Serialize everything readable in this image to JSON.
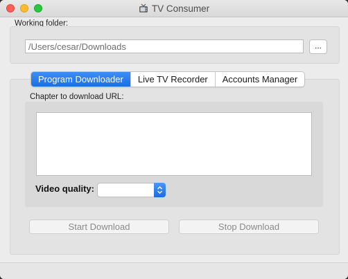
{
  "window": {
    "title": "TV Consumer",
    "title_icon": "tv-icon"
  },
  "folder": {
    "label": "Working folder:",
    "path_value": "/Users/cesar/Downloads",
    "browse_label": "..."
  },
  "tabs": [
    {
      "label": "Program Downloader",
      "active": true
    },
    {
      "label": "Live TV Recorder",
      "active": false
    },
    {
      "label": "Accounts Manager",
      "active": false
    }
  ],
  "downloader": {
    "url_label": "Chapter to download URL:",
    "url_value": "",
    "quality_label": "Video quality:",
    "quality_selected": "",
    "start_label": "Start Download",
    "stop_label": "Stop Download"
  },
  "colors": {
    "accent": "#1a6fe6",
    "window_bg": "#ececec",
    "disabled_text": "#8a8a8a"
  }
}
